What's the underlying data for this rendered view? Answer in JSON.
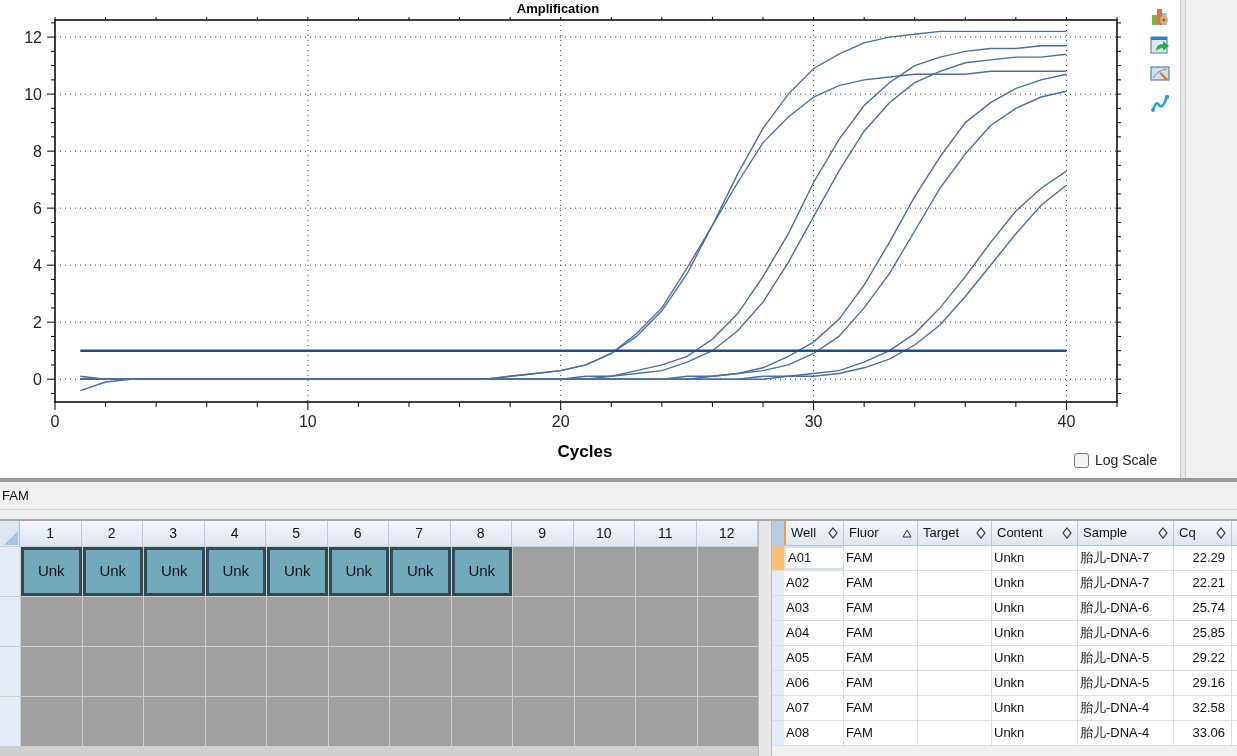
{
  "chart": {
    "chart_data": {
      "type": "line",
      "title": "Amplification",
      "xlabel": "Cycles",
      "x": [
        1,
        2,
        3,
        4,
        5,
        6,
        7,
        8,
        9,
        10,
        11,
        12,
        13,
        14,
        15,
        16,
        17,
        18,
        19,
        20,
        21,
        22,
        23,
        24,
        25,
        26,
        27,
        28,
        29,
        30,
        31,
        32,
        33,
        34,
        35,
        36,
        37,
        38,
        39,
        40
      ],
      "xlim": [
        0,
        42
      ],
      "ylim": [
        -0.8,
        12.6
      ],
      "xticks": [
        0,
        10,
        20,
        30,
        40
      ],
      "yticks": [
        0,
        2,
        4,
        6,
        8,
        10,
        12
      ],
      "series": [
        {
          "color": "#4a6fa0",
          "values": [
            0.1,
            0,
            0,
            0,
            0,
            0,
            0,
            0,
            0,
            0,
            0,
            0,
            0,
            0,
            0,
            0,
            0,
            0.1,
            0.2,
            0.3,
            0.5,
            0.9,
            1.5,
            2.4,
            3.7,
            5.4,
            7.2,
            8.8,
            10.0,
            10.9,
            11.4,
            11.8,
            12.0,
            12.1,
            12.2,
            12.2,
            12.2,
            12.2,
            12.2,
            12.2
          ]
        },
        {
          "color": "#4a6fa0",
          "values": [
            0,
            0,
            0,
            0,
            0,
            0,
            0,
            0,
            0,
            0,
            0,
            0,
            0,
            0,
            0,
            0,
            0,
            0.1,
            0.2,
            0.3,
            0.5,
            0.9,
            1.6,
            2.5,
            3.9,
            5.4,
            6.9,
            8.3,
            9.2,
            9.9,
            10.3,
            10.5,
            10.6,
            10.7,
            10.7,
            10.7,
            10.8,
            10.8,
            10.8,
            10.8
          ]
        },
        {
          "color": "#4a6fa0",
          "values": [
            0,
            0,
            0,
            0,
            0,
            0,
            0,
            0,
            0,
            0,
            0,
            0,
            0,
            0,
            0,
            0,
            0,
            0,
            0,
            0,
            0.1,
            0.1,
            0.3,
            0.5,
            0.8,
            1.4,
            2.3,
            3.6,
            5.1,
            6.9,
            8.4,
            9.6,
            10.4,
            11.0,
            11.3,
            11.5,
            11.6,
            11.6,
            11.7,
            11.7
          ]
        },
        {
          "color": "#4a6fa0",
          "values": [
            0,
            0,
            0,
            0,
            0,
            0,
            0,
            0,
            0,
            0,
            0,
            0,
            0,
            0,
            0,
            0,
            0,
            0,
            0,
            0,
            0,
            0.1,
            0.2,
            0.3,
            0.6,
            1.0,
            1.7,
            2.7,
            4.1,
            5.7,
            7.3,
            8.7,
            9.7,
            10.4,
            10.8,
            11.1,
            11.2,
            11.3,
            11.3,
            11.4
          ]
        },
        {
          "color": "#4a6fa0",
          "values": [
            0,
            0,
            0,
            0,
            0,
            0,
            0,
            0,
            0,
            0,
            0,
            0,
            0,
            0,
            0,
            0,
            0,
            0,
            0,
            0,
            0,
            0,
            0,
            0,
            0.1,
            0.1,
            0.2,
            0.4,
            0.8,
            1.3,
            2.1,
            3.3,
            4.8,
            6.4,
            7.8,
            9.0,
            9.7,
            10.2,
            10.5,
            10.7
          ]
        },
        {
          "color": "#4a6fa0",
          "values": [
            0,
            0,
            0,
            0,
            0,
            0,
            0,
            0,
            0,
            0,
            0,
            0,
            0,
            0,
            0,
            0,
            0,
            0,
            0,
            0,
            0,
            0,
            0,
            0,
            0,
            0.1,
            0.2,
            0.3,
            0.5,
            0.9,
            1.5,
            2.5,
            3.7,
            5.2,
            6.7,
            7.9,
            8.9,
            9.5,
            9.9,
            10.1
          ]
        },
        {
          "color": "#4a6fa0",
          "values": [
            0,
            0,
            0,
            0,
            0,
            0,
            0,
            0,
            0,
            0,
            0,
            0,
            0,
            0,
            0,
            0,
            0,
            0,
            0,
            0,
            0,
            0,
            0,
            0,
            0,
            0,
            0,
            0.1,
            0.1,
            0.2,
            0.3,
            0.6,
            1.0,
            1.6,
            2.5,
            3.6,
            4.8,
            5.9,
            6.7,
            7.3
          ]
        },
        {
          "color": "#4a6fa0",
          "values": [
            -0.4,
            -0.1,
            0,
            0,
            0,
            0,
            0,
            0,
            0,
            0,
            0,
            0,
            0,
            0,
            0,
            0,
            0,
            0,
            0,
            0,
            0,
            0,
            0,
            0,
            0,
            0,
            0,
            0,
            0.1,
            0.1,
            0.2,
            0.4,
            0.7,
            1.2,
            1.9,
            2.9,
            4.0,
            5.1,
            6.1,
            6.8
          ]
        }
      ],
      "grid": true,
      "ref_lines": [
        {
          "axis": "y",
          "value": 1
        }
      ]
    },
    "log_scale": {
      "label": "Log Scale",
      "checked": false
    }
  },
  "fluor_bar": {
    "label": "FAM"
  },
  "plate": {
    "columns": [
      "1",
      "2",
      "3",
      "4",
      "5",
      "6",
      "7",
      "8",
      "9",
      "10",
      "11",
      "12"
    ],
    "filled_wells": [
      "Unk",
      "Unk",
      "Unk",
      "Unk",
      "Unk",
      "Unk",
      "Unk",
      "Unk"
    ]
  },
  "table": {
    "columns": [
      {
        "label": "Well",
        "sorted": false
      },
      {
        "label": "Fluor",
        "sorted": true
      },
      {
        "label": "Target",
        "sorted": false
      },
      {
        "label": "Content",
        "sorted": false
      },
      {
        "label": "Sample",
        "sorted": false
      },
      {
        "label": "Cq",
        "sorted": false
      }
    ],
    "rows": [
      {
        "well": "A01",
        "fluor": "FAM",
        "content": "Unkn",
        "sample": "胎儿-DNA-7",
        "cq": "22.29",
        "selected": true
      },
      {
        "well": "A02",
        "fluor": "FAM",
        "content": "Unkn",
        "sample": "胎儿-DNA-7",
        "cq": "22.21",
        "selected": false
      },
      {
        "well": "A03",
        "fluor": "FAM",
        "content": "Unkn",
        "sample": "胎儿-DNA-6",
        "cq": "25.74",
        "selected": false
      },
      {
        "well": "A04",
        "fluor": "FAM",
        "content": "Unkn",
        "sample": "胎儿-DNA-6",
        "cq": "25.85",
        "selected": false
      },
      {
        "well": "A05",
        "fluor": "FAM",
        "content": "Unkn",
        "sample": "胎儿-DNA-5",
        "cq": "29.22",
        "selected": false
      },
      {
        "well": "A06",
        "fluor": "FAM",
        "content": "Unkn",
        "sample": "胎儿-DNA-5",
        "cq": "29.16",
        "selected": false
      },
      {
        "well": "A07",
        "fluor": "FAM",
        "content": "Unkn",
        "sample": "胎儿-DNA-4",
        "cq": "32.58",
        "selected": false
      },
      {
        "well": "A08",
        "fluor": "FAM",
        "content": "Unkn",
        "sample": "胎儿-DNA-4",
        "cq": "33.06",
        "selected": false
      }
    ]
  }
}
